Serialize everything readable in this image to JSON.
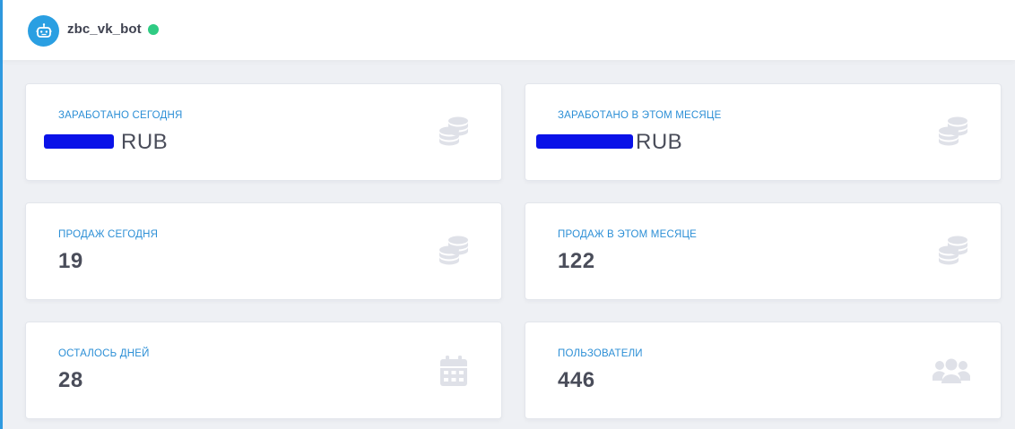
{
  "header": {
    "bot_name": "zbc_vk_bot",
    "status": "online",
    "status_color": "#2fcb83",
    "avatar_icon": "robot-icon",
    "accent_color": "#2a9fe2"
  },
  "cards": [
    {
      "label": "ЗАРАБОТАНО СЕГОДНЯ",
      "value": "RUB",
      "value_redacted": true,
      "icon": "coins-icon"
    },
    {
      "label": "ЗАРАБОТАНО В ЭТОМ МЕСЯЦЕ",
      "value": "RUB",
      "value_redacted": true,
      "icon": "coins-icon"
    },
    {
      "label": "ПРОДАЖ СЕГОДНЯ",
      "value": "19",
      "icon": "coins-icon"
    },
    {
      "label": "ПРОДАЖ В ЭТОМ МЕСЯЦЕ",
      "value": "122",
      "icon": "coins-icon"
    },
    {
      "label": "ОСТАЛОСЬ ДНЕЙ",
      "value": "28",
      "icon": "calendar-icon"
    },
    {
      "label": "ПОЛЬЗОВАТЕЛИ",
      "value": "446",
      "icon": "users-icon"
    }
  ],
  "colors": {
    "label": "#2c8fd6",
    "value": "#4a4d5a",
    "icon": "#dfe1e8",
    "background": "#eef0f4"
  }
}
